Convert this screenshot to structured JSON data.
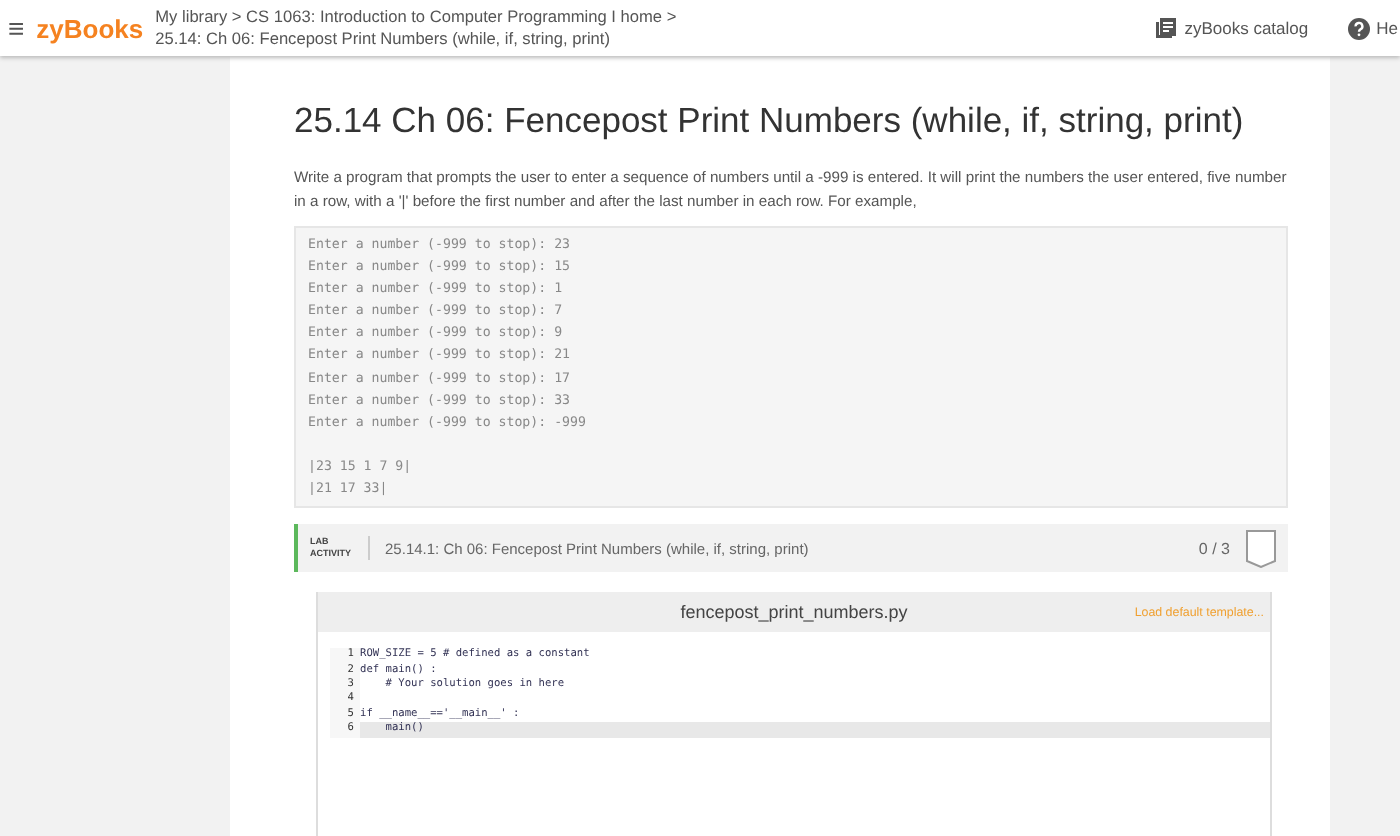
{
  "header": {
    "menu_icon": "≡",
    "logo": "zyBooks",
    "breadcrumb": [
      "My library > CS 1063: Introduction to Computer Programming I home >",
      "25.14: Ch 06: Fencepost Print Numbers (while, if, string, print)"
    ],
    "catalog": "zyBooks catalog",
    "help": "He"
  },
  "section": {
    "title": "25.14 Ch 06: Fencepost Print Numbers (while, if, string, print)",
    "description": "Write a program that prompts the user to enter a sequence of numbers until a -999 is entered. It will print the numbers the user entered, five number in a row, with a '|' before the first number and after the last number in each row. For example,",
    "sample_prompts": [
      "Enter a number (-999 to stop): 23",
      "Enter a number (-999 to stop): 15",
      "Enter a number (-999 to stop): 1",
      "Enter a number (-999 to stop): 7",
      "Enter a number (-999 to stop): 9",
      "Enter a number (-999 to stop): 21",
      "Enter a number (-999 to stop): 17",
      "Enter a number (-999 to stop): 33",
      "Enter a number (-999 to stop): -999"
    ],
    "sample_result": [
      "|23 15 1 7 9|",
      "|21 17 33|"
    ]
  },
  "lab": {
    "badge": [
      "LAB",
      "ACTIVITY"
    ],
    "title": "25.14.1: Ch 06: Fencepost Print Numbers (while, if, string, print)",
    "score": "0 / 3",
    "editor": {
      "filename": "fencepost_print_numbers.py",
      "load_template": "Load default template...",
      "lines": [
        {
          "number": "1",
          "code": "ROW_SIZE = 5 # defined as a constant",
          "selected": false
        },
        {
          "number": "2",
          "code": "def main() :",
          "selected": false
        },
        {
          "number": "3",
          "code": "    # Your solution goes in here",
          "selected": false
        },
        {
          "number": "4",
          "selected": false
        },
        {
          "number": "5",
          "code": "if __name__=='__main__' :",
          "selected": false
        },
        {
          "number": "6",
          "code": "    main()",
          "selected": true
        }
      ]
    }
  }
}
